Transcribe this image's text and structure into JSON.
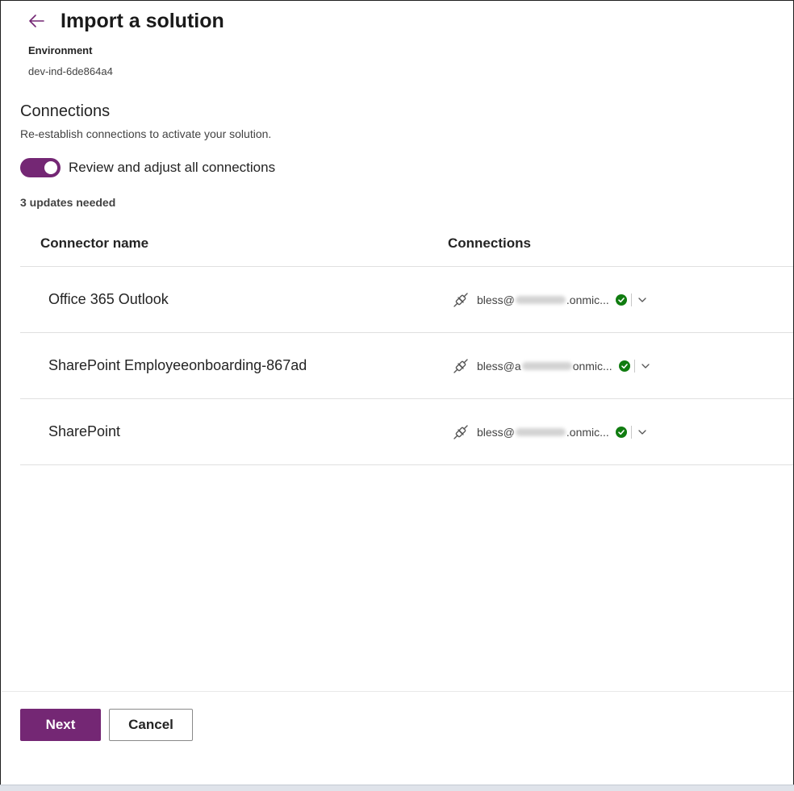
{
  "page": {
    "title": "Import a solution",
    "back_icon": "arrow-left-icon"
  },
  "environment": {
    "label": "Environment",
    "value": "dev-ind-6de864a4"
  },
  "connections_section": {
    "title": "Connections",
    "description": "Re-establish connections to activate your solution.",
    "toggle": {
      "label": "Review and adjust all connections",
      "on": true
    },
    "updates_needed": "3 updates needed"
  },
  "table": {
    "headers": {
      "connector_name": "Connector name",
      "connections": "Connections"
    },
    "rows": [
      {
        "connector": "Office 365 Outlook",
        "conn_prefix": "bless@",
        "conn_suffix": ".onmic...",
        "status": "connected"
      },
      {
        "connector": "SharePoint Employeeonboarding-867ad",
        "conn_prefix": "bless@a",
        "conn_suffix": "onmic...",
        "status": "connected"
      },
      {
        "connector": "SharePoint",
        "conn_prefix": "bless@",
        "conn_suffix": ".onmic...",
        "status": "connected"
      }
    ]
  },
  "footer": {
    "next_label": "Next",
    "cancel_label": "Cancel"
  },
  "colors": {
    "accent": "#742774",
    "success": "#107c10"
  }
}
